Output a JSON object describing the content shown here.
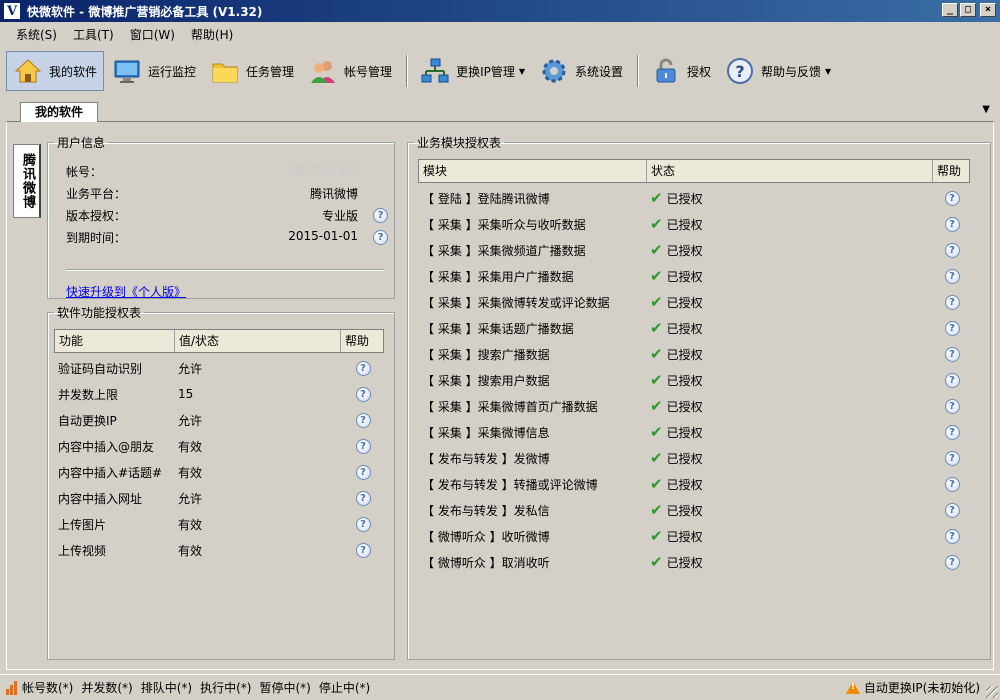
{
  "window": {
    "icon_letter": "V",
    "title": "快微软件 - 微博推广营销必备工具 (V1.32)"
  },
  "menu": [
    "系统(S)",
    "工具(T)",
    "窗口(W)",
    "帮助(H)"
  ],
  "toolbar": {
    "my_software": "我的软件",
    "monitor": "运行监控",
    "tasks": "任务管理",
    "accounts": "帐号管理",
    "change_ip": "更换IP管理",
    "settings": "系统设置",
    "authorize": "授权",
    "help_feedback": "帮助与反馈"
  },
  "tab": {
    "label": "我的软件"
  },
  "side_tab": "腾讯微博",
  "user_info": {
    "legend": "用户信息",
    "account_label": "帐号：",
    "account_value": "t8b9f3.com",
    "platform_label": "业务平台：",
    "platform_value": "腾讯微博",
    "edition_label": "版本授权：",
    "edition_value": "专业版",
    "expiry_label": "到期时间：",
    "expiry_value": "2015-01-01",
    "upgrade_link": "快速升级到《个人版》"
  },
  "func_auth": {
    "legend": "软件功能授权表",
    "headers": {
      "feature": "功能",
      "value": "值/状态",
      "help": "帮助"
    },
    "rows": [
      {
        "feature": "验证码自动识别",
        "value": "允许"
      },
      {
        "feature": "并发数上限",
        "value": "15"
      },
      {
        "feature": "自动更换IP",
        "value": "允许"
      },
      {
        "feature": "内容中插入@朋友",
        "value": "有效"
      },
      {
        "feature": "内容中插入#话题#",
        "value": "有效"
      },
      {
        "feature": "内容中插入网址",
        "value": "允许"
      },
      {
        "feature": "上传图片",
        "value": "有效"
      },
      {
        "feature": "上传视频",
        "value": "有效"
      }
    ]
  },
  "module_auth": {
    "legend": "业务模块授权表",
    "headers": {
      "module": "模块",
      "status": "状态",
      "help": "帮助"
    },
    "rows": [
      {
        "module": "【 登陆 】登陆腾讯微博",
        "status": "已授权"
      },
      {
        "module": "【 采集 】采集听众与收听数据",
        "status": "已授权"
      },
      {
        "module": "【 采集 】采集微频道广播数据",
        "status": "已授权"
      },
      {
        "module": "【 采集 】采集用户广播数据",
        "status": "已授权"
      },
      {
        "module": "【 采集 】采集微博转发或评论数据",
        "status": "已授权"
      },
      {
        "module": "【 采集 】采集话题广播数据",
        "status": "已授权"
      },
      {
        "module": "【 采集 】搜索广播数据",
        "status": "已授权"
      },
      {
        "module": "【 采集 】搜索用户数据",
        "status": "已授权"
      },
      {
        "module": "【 采集 】采集微博首页广播数据",
        "status": "已授权"
      },
      {
        "module": "【 采集 】采集微博信息",
        "status": "已授权"
      },
      {
        "module": "【 发布与转发 】发微博",
        "status": "已授权"
      },
      {
        "module": "【 发布与转发 】转播或评论微博",
        "status": "已授权"
      },
      {
        "module": "【 发布与转发 】发私信",
        "status": "已授权"
      },
      {
        "module": "【 微博听众 】收听微博",
        "status": "已授权"
      },
      {
        "module": "【 微博听众 】取消收听",
        "status": "已授权"
      }
    ]
  },
  "statusbar": {
    "items": [
      "帐号数(*)",
      "并发数(*)",
      "排队中(*)",
      "执行中(*)",
      "暂停中(*)",
      "停止中(*)"
    ],
    "auto_ip": "自动更换IP(未初始化)"
  },
  "colors": {
    "titlebar": "#0a246a",
    "check": "#2a9a2a",
    "warning": "#f08a00",
    "link": "#0000ee"
  }
}
